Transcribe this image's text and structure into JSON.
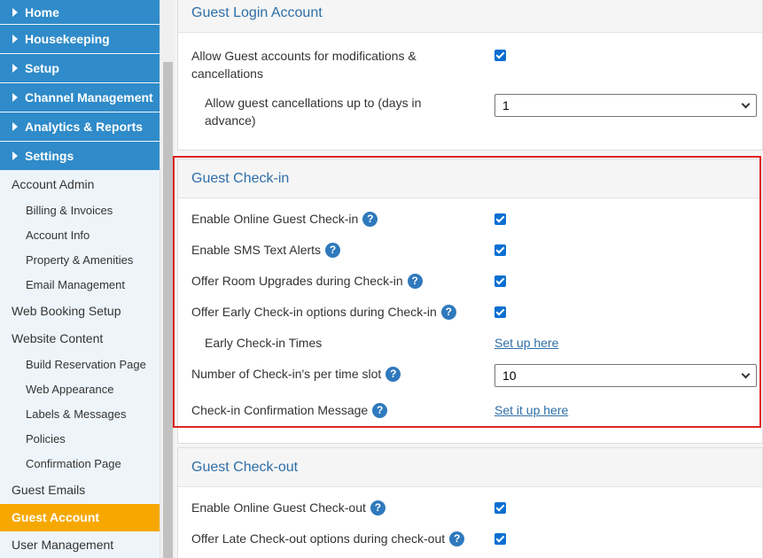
{
  "sidebar": {
    "main_items": [
      {
        "label": "Home"
      },
      {
        "label": "Housekeeping"
      },
      {
        "label": "Setup"
      },
      {
        "label": "Channel Management"
      },
      {
        "label": "Analytics & Reports"
      },
      {
        "label": "Settings"
      }
    ],
    "account_admin": "Account Admin",
    "billing": "Billing & Invoices",
    "account_info": "Account Info",
    "property": "Property & Amenities",
    "email_mgmt": "Email Management",
    "web_booking": "Web Booking Setup",
    "website_content": "Website Content",
    "build_reservation": "Build Reservation Page",
    "web_appearance": "Web Appearance",
    "labels_messages": "Labels & Messages",
    "policies": "Policies",
    "confirmation": "Confirmation Page",
    "guest_emails": "Guest Emails",
    "guest_account": "Guest Account",
    "user_mgmt": "User Management",
    "active_color": "#f7a800",
    "main_color": "#2f8bc9"
  },
  "login_panel": {
    "title": "Guest Login Account",
    "allow_accounts": "Allow Guest accounts for modifications & cancellations",
    "allow_accounts_checked": true,
    "cancellations_label": "Allow guest cancellations up to (days in advance)",
    "cancellations_value": "1"
  },
  "checkin_panel": {
    "title": "Guest Check-in",
    "enable_online": "Enable Online Guest Check-in",
    "enable_sms": "Enable SMS Text Alerts",
    "room_upgrades": "Offer Room Upgrades during Check-in",
    "early_options": "Offer Early Check-in options during Check-in",
    "early_times": "Early Check-in Times",
    "early_times_link": "Set up here",
    "per_slot": "Number of Check-in's per time slot",
    "per_slot_value": "10",
    "confirmation_msg": "Check-in Confirmation Message",
    "confirmation_link": "Set it up here",
    "help_glyph": "?"
  },
  "checkout_panel": {
    "title": "Guest Check-out",
    "enable_online": "Enable Online Guest Check-out",
    "late_options": "Offer Late Check-out options during check-out"
  },
  "colors": {
    "highlight": "#e02424",
    "link": "#2e6ea8",
    "checkbox": "#0b6fd1"
  }
}
